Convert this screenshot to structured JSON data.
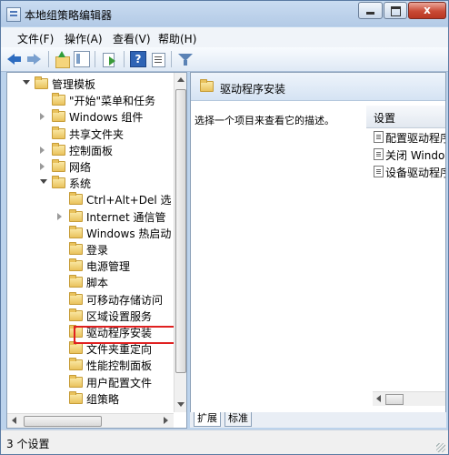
{
  "window": {
    "title": "本地组策略编辑器",
    "close_glyph": "x"
  },
  "menu": [
    "文件(F)",
    "操作(A)",
    "查看(V)",
    "帮助(H)"
  ],
  "toolbar": {
    "icons": [
      "back-icon",
      "forward-icon",
      "up-folder-icon",
      "show-tree-icon",
      "export-list-icon",
      "help-icon",
      "properties-icon",
      "filter-icon"
    ],
    "help_glyph": "?"
  },
  "tree": [
    {
      "label": "管理模板",
      "state": "expanded",
      "depth": 0
    },
    {
      "label": "\"开始\"菜单和任务",
      "state": "none",
      "depth": 1
    },
    {
      "label": "Windows 组件",
      "state": "collapsed",
      "depth": 1
    },
    {
      "label": "共享文件夹",
      "state": "none",
      "depth": 1
    },
    {
      "label": "控制面板",
      "state": "collapsed",
      "depth": 1
    },
    {
      "label": "网络",
      "state": "collapsed",
      "depth": 1
    },
    {
      "label": "系统",
      "state": "expanded",
      "depth": 1
    },
    {
      "label": "Ctrl+Alt+Del 选",
      "state": "none",
      "depth": 2
    },
    {
      "label": "Internet 通信管",
      "state": "collapsed",
      "depth": 2
    },
    {
      "label": "Windows 热启动",
      "state": "none",
      "depth": 2
    },
    {
      "label": "登录",
      "state": "none",
      "depth": 2
    },
    {
      "label": "电源管理",
      "state": "none",
      "depth": 2
    },
    {
      "label": "脚本",
      "state": "none",
      "depth": 2
    },
    {
      "label": "可移动存储访问",
      "state": "none",
      "depth": 2
    },
    {
      "label": "区域设置服务",
      "state": "none",
      "depth": 2
    },
    {
      "label": "驱动程序安装",
      "state": "none",
      "depth": 2,
      "selected": true
    },
    {
      "label": "文件夹重定向",
      "state": "none",
      "depth": 2
    },
    {
      "label": "性能控制面板",
      "state": "none",
      "depth": 2
    },
    {
      "label": "用户配置文件",
      "state": "none",
      "depth": 2
    },
    {
      "label": "组策略",
      "state": "none",
      "depth": 2
    }
  ],
  "detail": {
    "header_title": "驱动程序安装",
    "description": "选择一个项目来查看它的描述。",
    "column_header": "设置",
    "items": [
      "配置驱动程序",
      "关闭 Windows",
      "设备驱动程序"
    ]
  },
  "tabs": [
    "扩展",
    "标准"
  ],
  "status": "3 个设置"
}
